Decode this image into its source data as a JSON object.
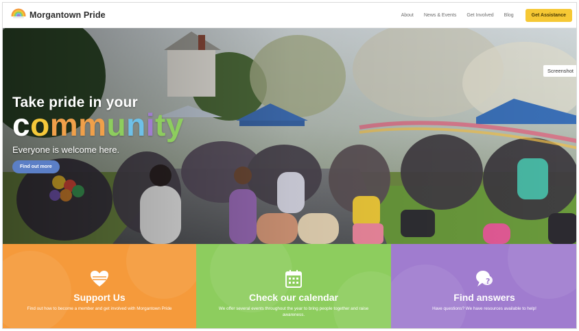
{
  "header": {
    "brand": "Morgantown Pride",
    "nav": [
      "About",
      "News & Events",
      "Get Involved",
      "Blog"
    ],
    "assist_label": "Get Assistance"
  },
  "hero": {
    "title": "Take pride in your",
    "highlight_letters": [
      "c",
      "o",
      "m",
      "m",
      "u",
      "n",
      "i",
      "t",
      "y"
    ],
    "subtitle": "Everyone is welcome here.",
    "button_label": "Find out more",
    "screenshot_tag": "Screenshot"
  },
  "tiles": [
    {
      "icon": "heart-icon",
      "title": "Support Us",
      "text": "Find out how to become a member and get involved with Morgantown Pride",
      "color": "#f59a3b"
    },
    {
      "icon": "calendar-icon",
      "title": "Check our calendar",
      "text": "We offer several events throughout the year to bring people together and raise awareness.",
      "color": "#8dcd5e"
    },
    {
      "icon": "question-chat-icon",
      "title": "Find answers",
      "text": "Have questions? We have resources available to help!",
      "color": "#a07ccf"
    }
  ],
  "colors": {
    "community": [
      "#ffffff",
      "#f5c93a",
      "#f0a04a",
      "#f0a04a",
      "#8dcd5e",
      "#6ec0e8",
      "#a07ccf",
      "#8dcd5e",
      "#8dcd5e"
    ],
    "accent": "#f6c834",
    "button": "#5b7fc6"
  }
}
